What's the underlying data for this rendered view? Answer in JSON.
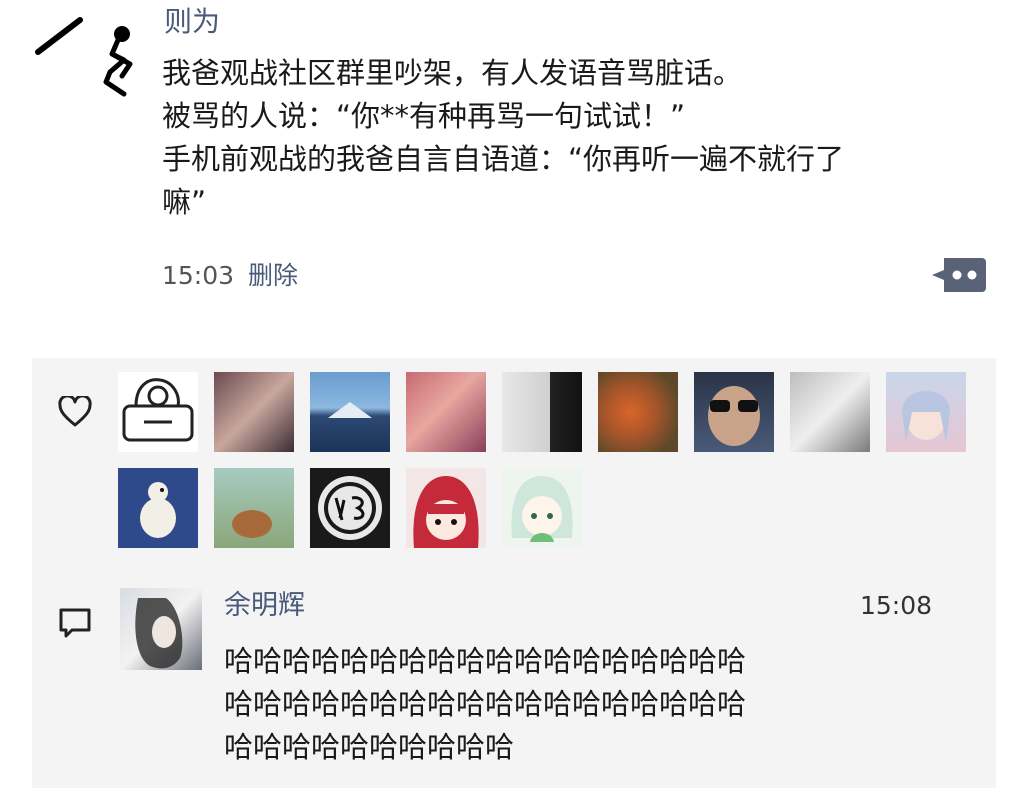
{
  "post": {
    "author": "则为",
    "lines": [
      "我爸观战社区群里吵架，有人发语音骂脏话。",
      "被骂的人说：“你**有种再骂一句试试！”",
      "手机前观战的我爸自言自语道：“你再听一遍不就行了",
      "嘛”"
    ],
    "time": "15:03",
    "delete_label": "删除"
  },
  "likes": {
    "icon": "heart-icon",
    "avatars": [
      {
        "name": "liker-avatar-sketch-armchair"
      },
      {
        "name": "liker-avatar-blurred-photo"
      },
      {
        "name": "liker-avatar-mountain-lake"
      },
      {
        "name": "liker-avatar-pink-portrait"
      },
      {
        "name": "liker-avatar-grey-figure"
      },
      {
        "name": "liker-avatar-autumn-leaves"
      },
      {
        "name": "liker-avatar-sunglasses-man"
      },
      {
        "name": "liker-avatar-grey-figure-2"
      },
      {
        "name": "liker-avatar-anime-blue-hair"
      },
      {
        "name": "liker-avatar-blue-penguin"
      },
      {
        "name": "liker-avatar-cartoon-outdoor"
      },
      {
        "name": "liker-avatar-fat-logo"
      },
      {
        "name": "liker-avatar-anime-red-hair"
      },
      {
        "name": "liker-avatar-anime-green-hair"
      }
    ]
  },
  "comment": {
    "icon": "comment-icon",
    "author": "余明辉",
    "time": "15:08",
    "lines": [
      "哈哈哈哈哈哈哈哈哈哈哈哈哈哈哈哈哈哈",
      "哈哈哈哈哈哈哈哈哈哈哈哈哈哈哈哈哈哈",
      "哈哈哈哈哈哈哈哈哈哈"
    ]
  },
  "colors": {
    "name_link": "#4a5a7a",
    "panel_bg": "#f4f4f4",
    "comment_button": "#5a6278"
  }
}
